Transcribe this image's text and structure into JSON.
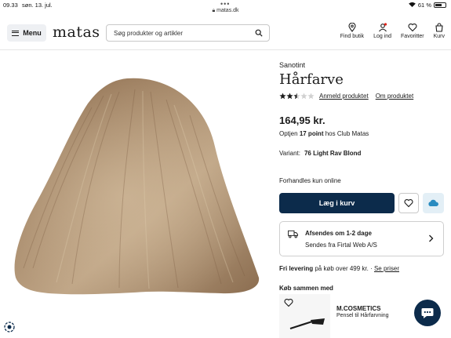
{
  "status_bar": {
    "time": "09.33",
    "date": "søn. 13. jul.",
    "url": "matas.dk",
    "battery": "61 %"
  },
  "header": {
    "menu_label": "Menu",
    "logo": "matas",
    "search_placeholder": "Søg produkter og artikler",
    "nav": [
      {
        "label": "Find butik",
        "icon": "location-pin-icon"
      },
      {
        "label": "Log ind",
        "icon": "user-icon"
      },
      {
        "label": "Favoritter",
        "icon": "heart-icon"
      },
      {
        "label": "Kurv",
        "icon": "bag-icon"
      }
    ]
  },
  "product": {
    "brand": "Sanotint",
    "title": "Hårfarve",
    "rating": 2.5,
    "rating_max": 5,
    "review_link": "Anmeld produktet",
    "about_link": "Om produktet",
    "price": "164,95 kr.",
    "points_prefix": "Optjen",
    "points": "17 point",
    "points_suffix": "hos Club Matas",
    "variant_label": "Variant:",
    "variant_value": "76 Light Rav Blond",
    "online_only": "Forhandles kun online",
    "add_to_cart": "Læg i kurv"
  },
  "shipping": {
    "title": "Afsendes om 1-2 dage",
    "subtitle": "Sendes fra Firtal Web A/S"
  },
  "delivery": {
    "bold": "Fri levering",
    "text": "på køb over 499 kr. ·",
    "link": "Se priser"
  },
  "buy_together": {
    "title": "Køb sammen med",
    "item_brand": "M.COSMETICS",
    "item_name": "Pensel til Hårfarvning"
  },
  "colors": {
    "primary": "#0c2b4b",
    "cloud_bg": "#e3eff6",
    "cloud_icon": "#2a8bc0"
  }
}
